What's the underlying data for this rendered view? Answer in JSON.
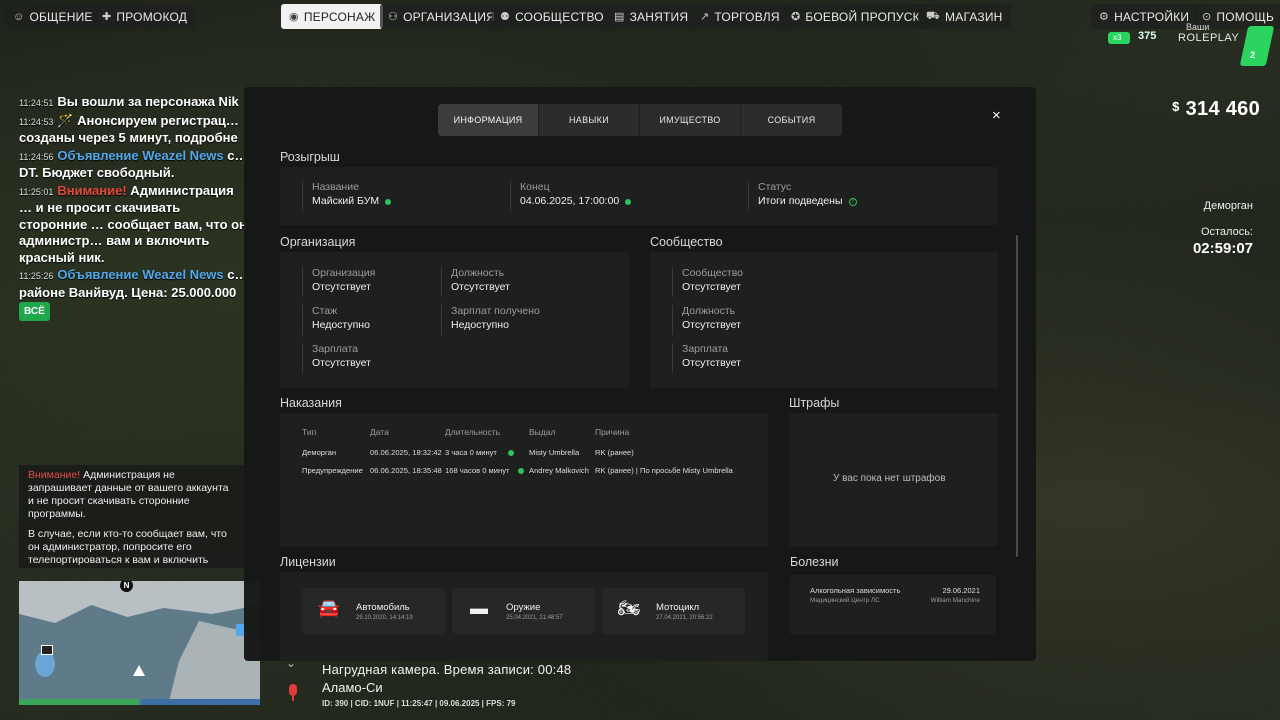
{
  "topbar": {
    "left": [
      {
        "label": "ОБЩЕНИЕ",
        "icon": "chat-icon",
        "glyph": "☺"
      },
      {
        "label": "ПРОМОКОД",
        "icon": "promo-icon",
        "glyph": "✚"
      }
    ],
    "center": [
      {
        "label": "ПЕРСОНАЖ",
        "icon": "user-icon",
        "glyph": "◉",
        "active": true
      },
      {
        "label": "ОРГАНИЗАЦИЯ",
        "icon": "organization-icon",
        "glyph": "⚇"
      },
      {
        "label": "СООБЩЕСТВО",
        "icon": "community-icon",
        "glyph": "⚉"
      },
      {
        "label": "ЗАНЯТИЯ",
        "icon": "activities-icon",
        "glyph": "▤"
      },
      {
        "label": "ТОРГОВЛЯ",
        "icon": "trade-icon",
        "glyph": "↗"
      },
      {
        "label": "БОЕВОЙ ПРОПУСК",
        "icon": "battlepass-icon",
        "glyph": "✪"
      },
      {
        "label": "МАГАЗИН",
        "icon": "cart-icon",
        "glyph": "⛟"
      }
    ],
    "right": [
      {
        "label": "НАСТРОЙКИ",
        "icon": "gear-icon",
        "glyph": "⚙"
      },
      {
        "label": "ПОМОЩЬ",
        "icon": "help-icon",
        "glyph": "⊙"
      }
    ]
  },
  "brand": {
    "multiplier": "x3",
    "online": "375",
    "name": "ROLEPLAY",
    "name_top": "Ваши",
    "server": "2"
  },
  "money": {
    "currency": "$",
    "amount": "314 460"
  },
  "status": {
    "name": "Деморган",
    "left_label": "Осталось:",
    "left_time": "02:59:07"
  },
  "chat": {
    "lines": [
      {
        "time": "11:24:51",
        "prefix": "",
        "text": "Вы вошли за персонажа Nik"
      },
      {
        "time": "11:24:53",
        "prefix": "",
        "text": "🪄 Анонсируем регистрац… созданы через 5 минут, подробне"
      },
      {
        "time": "11:24:56",
        "prefix": "Объявление Weazel News",
        "text": " с… DT. Бюджет свободный."
      },
      {
        "time": "11:25:01",
        "prefix": "Внимание!",
        "text": " Администрация … и не просит скачивать сторонние … сообщает вам, что он администр… вам и включить красный ник."
      },
      {
        "time": "11:25:26",
        "prefix": "Объявление Weazel News",
        "text": " с… районе Ванйвуд. Цена: 25.000.000"
      }
    ],
    "all_button": "ВСЁ"
  },
  "notice": {
    "warn": "Внимание!",
    "p1": " Администрация не запрашивает данные от вашего аккаунта и не просит скачивать сторонние программы.",
    "p2": "В случае, если кто-то сообщает вам, что он администратор, попросите его телепортироваться к вам и включить красный ник."
  },
  "minimap": {
    "north": "N"
  },
  "vitals": {
    "health": 1.0,
    "armor": 1.0
  },
  "hud": {
    "camera": "Нагрудная камера. Время записи: 00:48",
    "location": "Аламо-Си",
    "ids": "ID: 390 | CID: 1NUF | 11:25:47 | 09.06.2025 | FPS: 79"
  },
  "modal": {
    "tabs": [
      {
        "label": "ИНФОРМАЦИЯ",
        "active": true
      },
      {
        "label": "НАВЫКИ"
      },
      {
        "label": "ИМУЩЕСТВО"
      },
      {
        "label": "СОБЫТИЯ"
      }
    ],
    "close": "×",
    "raffle": {
      "title": "Розыгрыш",
      "name_label": "Название",
      "name_value": "Майский БУМ",
      "end_label": "Конец",
      "end_value": "04.06.2025, 17:00:00",
      "status_label": "Статус",
      "status_value": "Итоги подведены"
    },
    "organization": {
      "title": "Организация",
      "org_label": "Организация",
      "org_value": "Отсутствует",
      "pos_label": "Должность",
      "pos_value": "Отсутствует",
      "exp_label": "Стаж",
      "exp_value": "Недоступно",
      "salary_got_label": "Зарплат получено",
      "salary_got_value": "Недоступно",
      "salary_label": "Зарплата",
      "salary_value": "Отсутствует"
    },
    "community": {
      "title": "Сообщество",
      "comm_label": "Сообщество",
      "comm_value": "Отсутствует",
      "pos_label": "Должность",
      "pos_value": "Отсутствует",
      "salary_label": "Зарплата",
      "salary_value": "Отсутствует"
    },
    "punishments": {
      "title": "Наказания",
      "headers": [
        "Тип",
        "Дата",
        "Длительность",
        "Выдал",
        "Причина"
      ],
      "rows": [
        {
          "type": "Деморган",
          "date": "06.06.2025, 18:32:42",
          "duration": "3 часа 0 минут",
          "issuer": "Misty Umbrella",
          "reason": "RK (ранее)"
        },
        {
          "type": "Предупреждение",
          "date": "06.06.2025, 18:35:48",
          "duration": "168 часов 0 минут",
          "issuer": "Andrey Malkovich",
          "reason": "RK (ранее) | По просьбе Misty Umbrella"
        }
      ]
    },
    "fines": {
      "title": "Штрафы",
      "empty": "У вас пока нет штрафов"
    },
    "licenses": {
      "title": "Лицензии",
      "items": [
        {
          "name": "Автомобиль",
          "date": "29.10.2020, 14:14:19",
          "icon": "car-icon",
          "glyph": "🚘"
        },
        {
          "name": "Оружие",
          "date": "25.04.2021, 21:48:57",
          "icon": "gun-icon",
          "glyph": "▬"
        },
        {
          "name": "Мотоцикл",
          "date": "27.04.2021, 20:56:22",
          "icon": "motorcycle-icon",
          "glyph": "🏍"
        }
      ]
    },
    "diseases": {
      "title": "Болезни",
      "items": [
        {
          "name": "Алкогольная зависимость",
          "date": "29.06.2021",
          "org": "Медицинский Центр ЛС",
          "who": "William Manchine"
        }
      ]
    }
  }
}
